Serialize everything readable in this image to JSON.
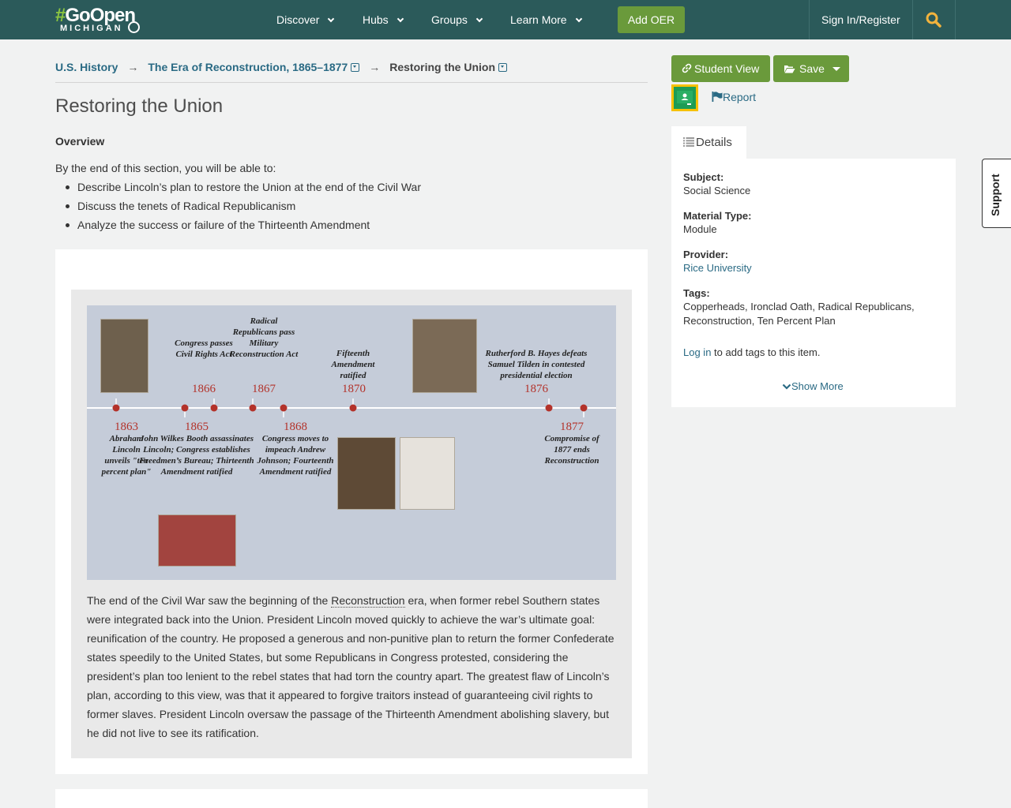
{
  "nav": {
    "logo_top": "GoOpen",
    "logo_hash": "#",
    "logo_bottom": "MICHIGAN",
    "items": [
      {
        "label": "Discover"
      },
      {
        "label": "Hubs"
      },
      {
        "label": "Groups"
      },
      {
        "label": "Learn More"
      }
    ],
    "add_oer": "Add OER",
    "signin": "Sign In/Register"
  },
  "breadcrumb": {
    "items": [
      "U.S. History",
      "The Era of Reconstruction, 1865–1877",
      "Restoring the Union"
    ],
    "arrow": "→"
  },
  "page": {
    "title": "Restoring the Union",
    "overview_heading": "Overview",
    "overview_intro": "By the end of this section, you will be able to:",
    "objectives": [
      "Describe Lincoln’s plan to restore the Union at the end of the Civil War",
      "Discuss the tenets of Radical Republicanism",
      "Analyze the success or failure of the Thirteenth Amendment"
    ]
  },
  "timeline": {
    "top": [
      {
        "year": "1866",
        "caption": "Congress passes Civil Rights Act"
      },
      {
        "year": "1867",
        "caption": "Radical Republicans pass Military Reconstruction Act"
      },
      {
        "year": "1870",
        "caption": "Fifteenth Amendment ratified"
      },
      {
        "year": "1876",
        "caption": "Rutherford B. Hayes defeats Samuel Tilden in contested presidential election"
      }
    ],
    "bottom": [
      {
        "year": "1863",
        "caption": "Abraham Lincoln unveils \"ten percent plan\""
      },
      {
        "year": "1865",
        "caption": "John Wilkes Booth assassinates Lincoln; Congress establishes Freedmen’s Bureau; Thirteenth Amendment ratified"
      },
      {
        "year": "1868",
        "caption": "Congress moves to impeach Andrew Johnson; Fourteenth Amendment ratified"
      },
      {
        "year": "1877",
        "caption": "Compromise of 1877 ends Reconstruction"
      }
    ]
  },
  "body": {
    "before_term": "The end of the Civil War saw the beginning of the ",
    "term": "Reconstruction",
    "after_term": " era, when former rebel Southern states were integrated back into the Union. President Lincoln moved quickly to achieve the war’s ultimate goal: reunification of the country. He proposed a generous and non-punitive plan to return the former Confederate states speedily to the United States, but some Republicans in Congress protested, considering the president’s plan too lenient to the rebel states that had torn the country apart. The greatest flaw of Lincoln’s plan, according to this view, was that it appeared to forgive traitors instead of guaranteeing civil rights to former slaves. President Lincoln oversaw the passage of the Thirteenth Amendment abolishing slavery, but he did not live to see its ratification."
  },
  "sidebar": {
    "student_view": "Student View",
    "save": "Save",
    "report": "Report",
    "details_tab": "Details",
    "subject_label": "Subject:",
    "subject_value": "Social Science",
    "material_label": "Material Type:",
    "material_value": "Module",
    "provider_label": "Provider:",
    "provider_value": "Rice University",
    "tags_label": "Tags:",
    "tags_value": "Copperheads, Ironclad Oath, Radical Republicans, Reconstruction, Ten Percent Plan",
    "login_link": "Log in",
    "login_suffix": " to add tags to this item.",
    "show_more": "Show More",
    "support": "Support"
  },
  "colors": {
    "topbar": "#2b5a5a",
    "accent_green": "#6a9a3b",
    "link": "#2a6a84",
    "timeline_red": "#b3322a"
  }
}
